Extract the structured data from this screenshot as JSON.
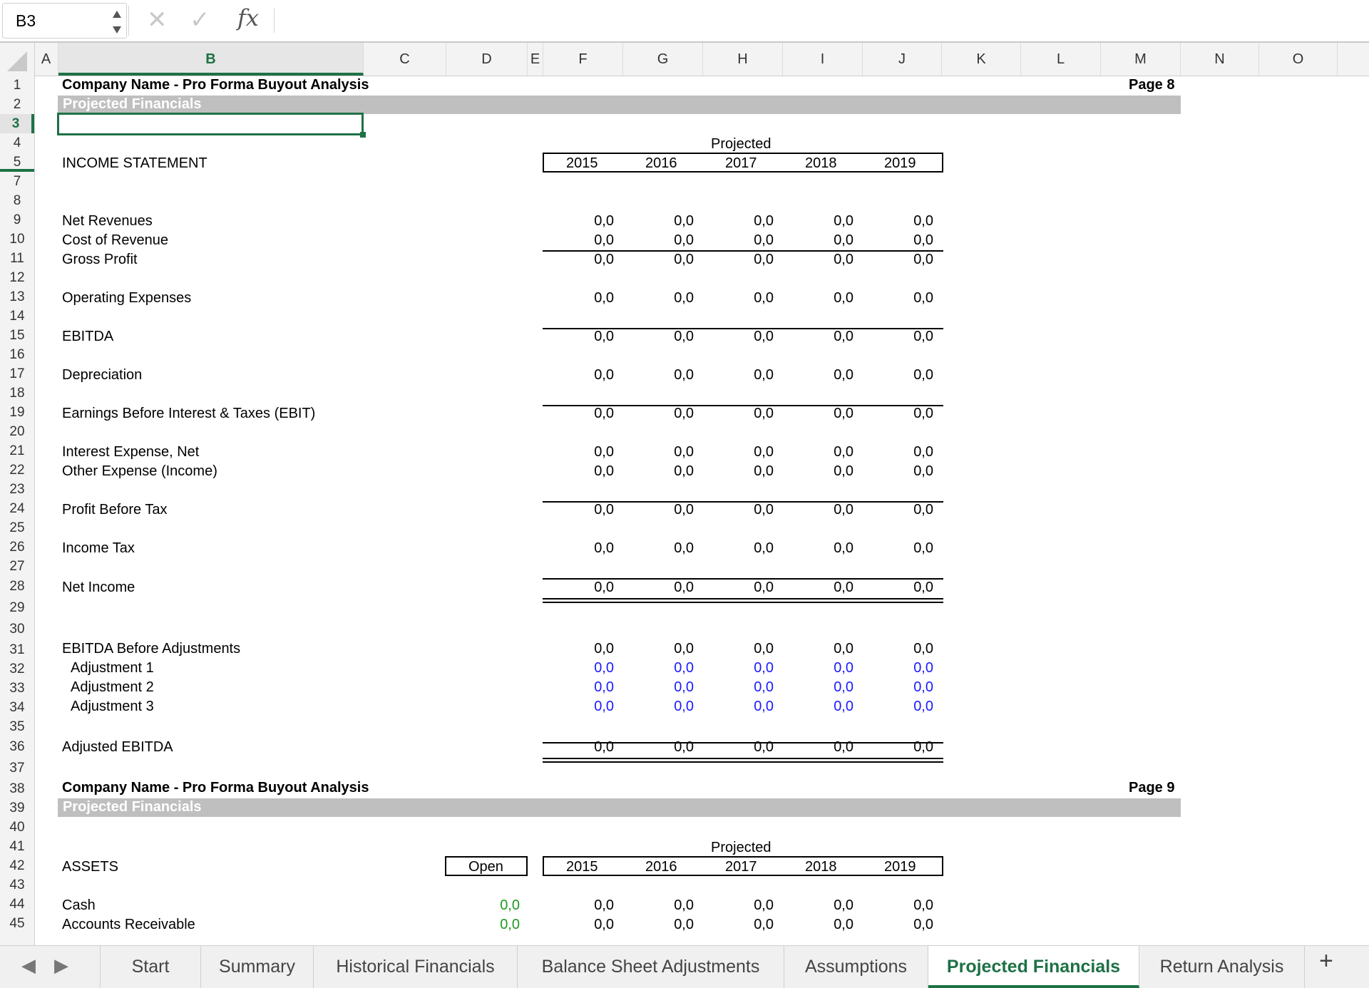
{
  "formula_bar": {
    "cell_ref": "B3",
    "fx": "fx",
    "formula": ""
  },
  "columns": [
    "A",
    "B",
    "C",
    "D",
    "E",
    "F",
    "G",
    "H",
    "I",
    "J",
    "K",
    "L",
    "M",
    "N",
    "O"
  ],
  "rows": [
    "1",
    "2",
    "3",
    "4",
    "5",
    "7",
    "8",
    "9",
    "10",
    "11",
    "12",
    "13",
    "14",
    "15",
    "16",
    "17",
    "18",
    "19",
    "20",
    "21",
    "22",
    "23",
    "24",
    "25",
    "26",
    "27",
    "28",
    "29",
    "30",
    "31",
    "32",
    "33",
    "34",
    "35",
    "36",
    "37",
    "38",
    "39",
    "40",
    "41",
    "42",
    "43",
    "44",
    "45"
  ],
  "page8": {
    "title": "Company Name - Pro Forma Buyout Analysis",
    "page": "Page 8",
    "band": "Projected Financials",
    "projected": "Projected",
    "section": "INCOME STATEMENT",
    "years": [
      "2015",
      "2016",
      "2017",
      "2018",
      "2019"
    ],
    "line_items": [
      {
        "label": "Net Revenues",
        "values": [
          "0,0",
          "0,0",
          "0,0",
          "0,0",
          "0,0"
        ]
      },
      {
        "label": "Cost of Revenue",
        "values": [
          "0,0",
          "0,0",
          "0,0",
          "0,0",
          "0,0"
        ]
      },
      {
        "label": "Gross Profit",
        "values": [
          "0,0",
          "0,0",
          "0,0",
          "0,0",
          "0,0"
        ]
      },
      {
        "label": "Operating Expenses",
        "values": [
          "0,0",
          "0,0",
          "0,0",
          "0,0",
          "0,0"
        ]
      },
      {
        "label": "EBITDA",
        "values": [
          "0,0",
          "0,0",
          "0,0",
          "0,0",
          "0,0"
        ]
      },
      {
        "label": "Depreciation",
        "values": [
          "0,0",
          "0,0",
          "0,0",
          "0,0",
          "0,0"
        ]
      },
      {
        "label": "Earnings Before Interest & Taxes (EBIT)",
        "values": [
          "0,0",
          "0,0",
          "0,0",
          "0,0",
          "0,0"
        ]
      },
      {
        "label": "Interest Expense, Net",
        "values": [
          "0,0",
          "0,0",
          "0,0",
          "0,0",
          "0,0"
        ]
      },
      {
        "label": "Other Expense (Income)",
        "values": [
          "0,0",
          "0,0",
          "0,0",
          "0,0",
          "0,0"
        ]
      },
      {
        "label": "Profit Before Tax",
        "values": [
          "0,0",
          "0,0",
          "0,0",
          "0,0",
          "0,0"
        ]
      },
      {
        "label": "Income Tax",
        "values": [
          "0,0",
          "0,0",
          "0,0",
          "0,0",
          "0,0"
        ]
      },
      {
        "label": "Net Income",
        "values": [
          "0,0",
          "0,0",
          "0,0",
          "0,0",
          "0,0"
        ]
      },
      {
        "label": "EBITDA Before Adjustments",
        "values": [
          "0,0",
          "0,0",
          "0,0",
          "0,0",
          "0,0"
        ]
      },
      {
        "label": "Adjustment 1",
        "values": [
          "0,0",
          "0,0",
          "0,0",
          "0,0",
          "0,0"
        ]
      },
      {
        "label": "Adjustment 2",
        "values": [
          "0,0",
          "0,0",
          "0,0",
          "0,0",
          "0,0"
        ]
      },
      {
        "label": "Adjustment 3",
        "values": [
          "0,0",
          "0,0",
          "0,0",
          "0,0",
          "0,0"
        ]
      },
      {
        "label": "Adjusted EBITDA",
        "values": [
          "0,0",
          "0,0",
          "0,0",
          "0,0",
          "0,0"
        ]
      }
    ]
  },
  "page9": {
    "title": "Company Name - Pro Forma Buyout Analysis",
    "page": "Page 9",
    "band": "Projected Financials",
    "projected": "Projected",
    "section": "ASSETS",
    "open_label": "Open",
    "years": [
      "2015",
      "2016",
      "2017",
      "2018",
      "2019"
    ],
    "line_items": [
      {
        "label": "Cash",
        "open": "0,0",
        "values": [
          "0,0",
          "0,0",
          "0,0",
          "0,0",
          "0,0"
        ]
      },
      {
        "label": "Accounts Receivable",
        "open": "0,0",
        "values": [
          "0,0",
          "0,0",
          "0,0",
          "0,0",
          "0,0"
        ]
      }
    ]
  },
  "tabs": [
    "Start",
    "Summary",
    "Historical Financials",
    "Balance Sheet Adjustments",
    "Assumptions",
    "Projected Financials",
    "Return Analysis"
  ],
  "active_tab": "Projected Financials",
  "colors": {
    "accent": "#1e7145",
    "input_blue": "#1a1aff",
    "link_green": "#1f9a1f",
    "band_gray": "#bfbfbf"
  }
}
